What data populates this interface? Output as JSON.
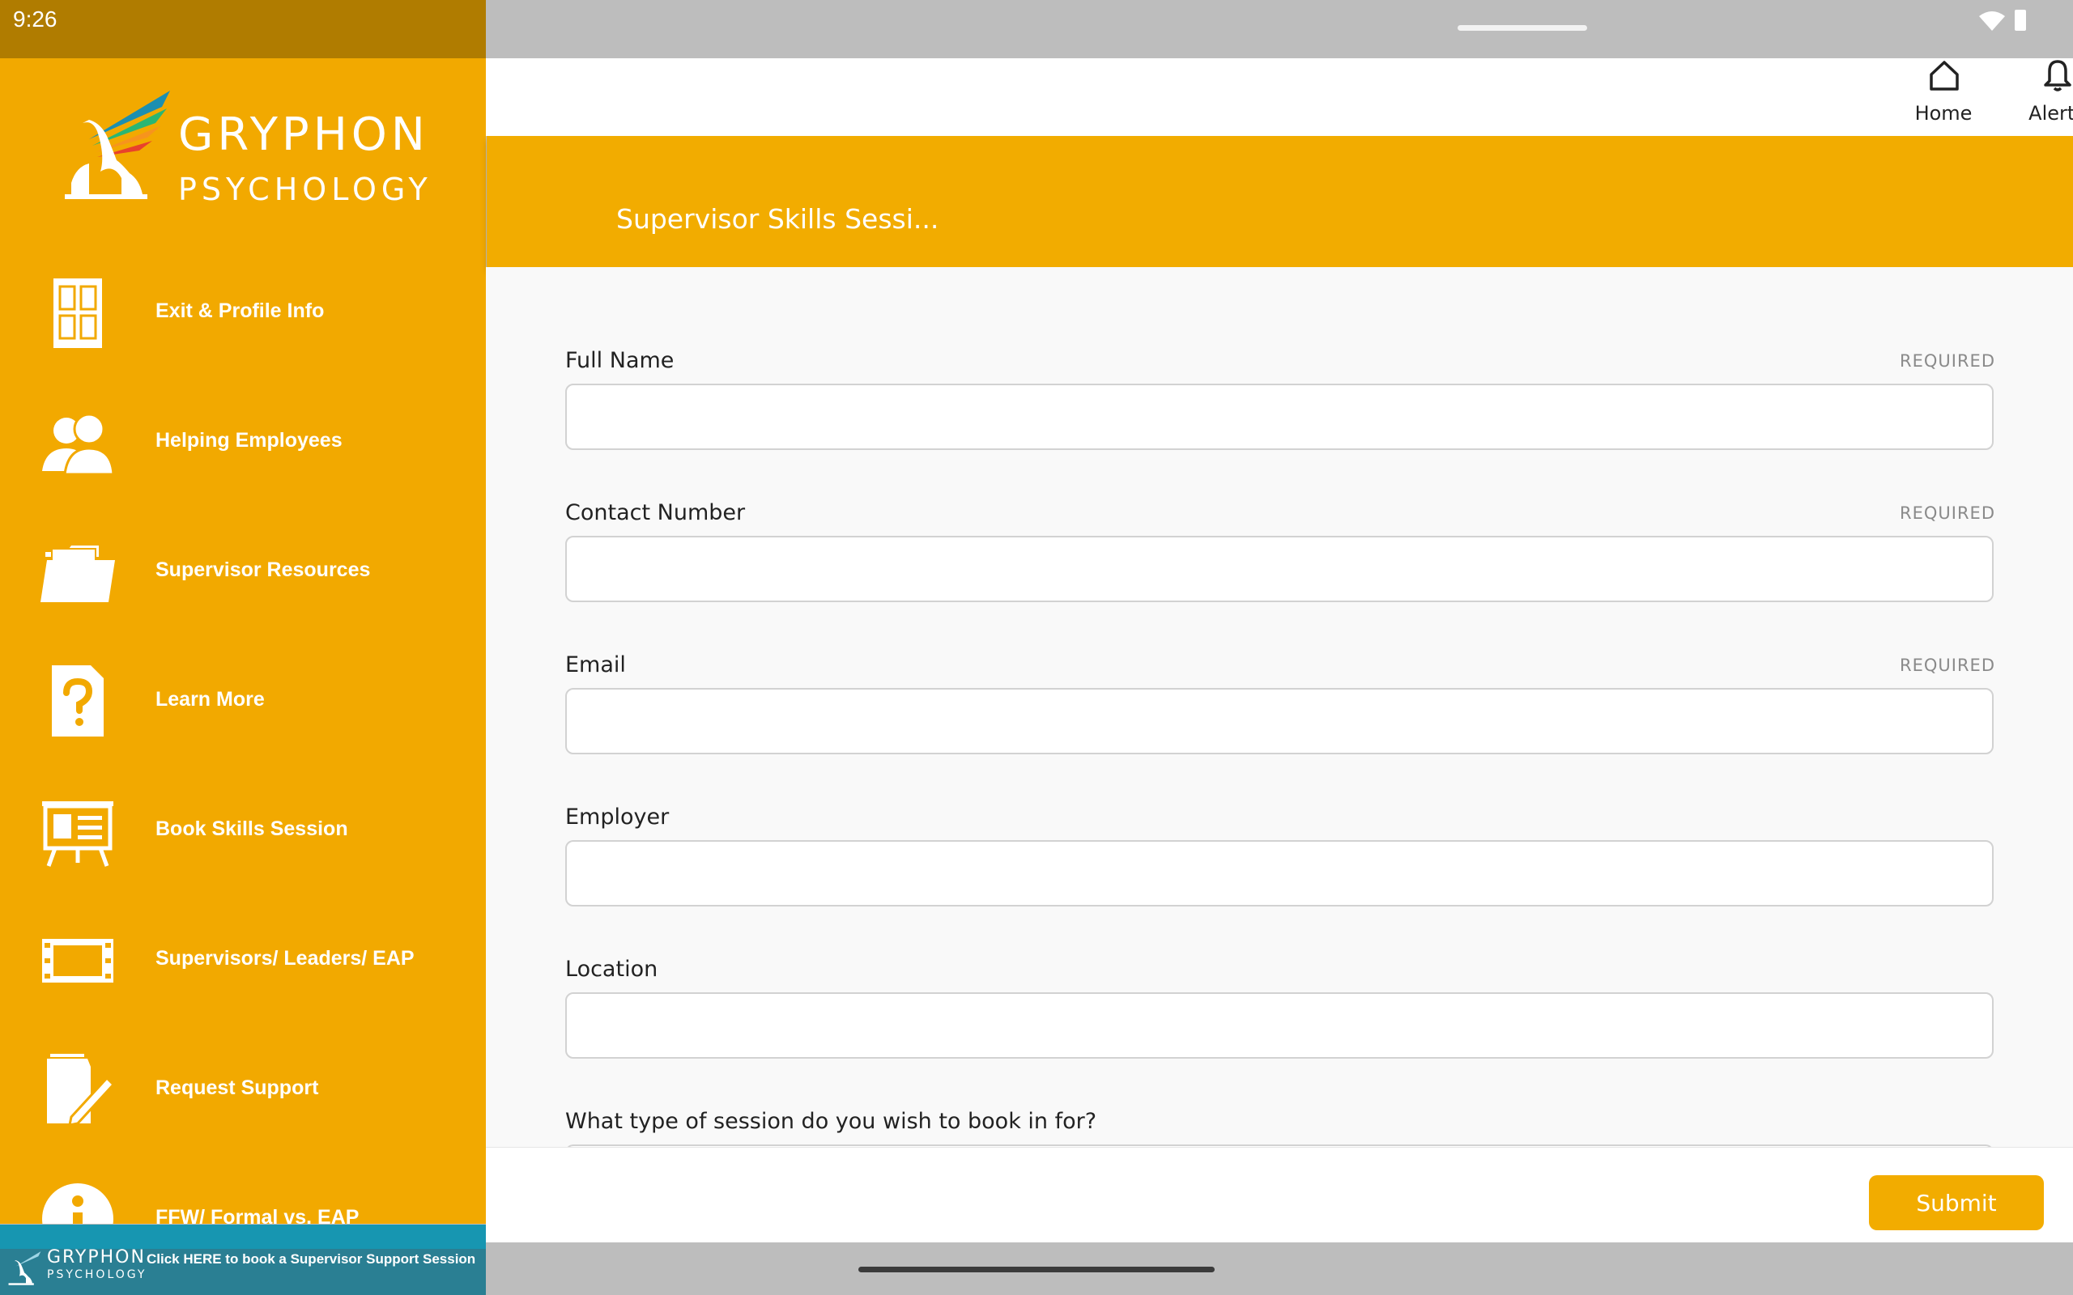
{
  "status_bar": {
    "time": "9:26"
  },
  "sidebar": {
    "logo": {
      "line1": "GRYPHON",
      "line2": "PSYCHOLOGY"
    },
    "items": [
      {
        "label": "Exit & Profile Info",
        "icon": "door-icon"
      },
      {
        "label": "Helping Employees",
        "icon": "people-icon"
      },
      {
        "label": "Supervisor Resources",
        "icon": "folder-icon"
      },
      {
        "label": "Learn More",
        "icon": "question-doc-icon"
      },
      {
        "label": "Book Skills Session",
        "icon": "presentation-board-icon"
      },
      {
        "label": "Supervisors/ Leaders/ EAP",
        "icon": "film-strip-icon"
      },
      {
        "label": "Request Support",
        "icon": "notebook-pen-icon"
      },
      {
        "label": "FFW/ Formal vs. EAP",
        "icon": "info-icon"
      }
    ],
    "banner": {
      "logo_line1": "GRYPHON",
      "logo_line2": "PSYCHOLOGY",
      "text": "Click HERE to book a Supervisor Support Session"
    }
  },
  "topbar": {
    "home_label": "Home",
    "alerts_label": "Alerts"
  },
  "header": {
    "title": "Supervisor Skills Sessi..."
  },
  "form": {
    "fields": [
      {
        "label": "Full Name",
        "required": "REQUIRED",
        "value": ""
      },
      {
        "label": "Contact Number",
        "required": "REQUIRED",
        "value": ""
      },
      {
        "label": "Email",
        "required": "REQUIRED",
        "value": ""
      },
      {
        "label": "Employer",
        "value": ""
      },
      {
        "label": "Location",
        "value": ""
      }
    ],
    "question": "What type of session do you wish to book in for?",
    "submit_label": "Submit"
  },
  "colors": {
    "brand": "#f2ac00",
    "status_bar": "#b07c00",
    "banner": "#2a7f93"
  }
}
